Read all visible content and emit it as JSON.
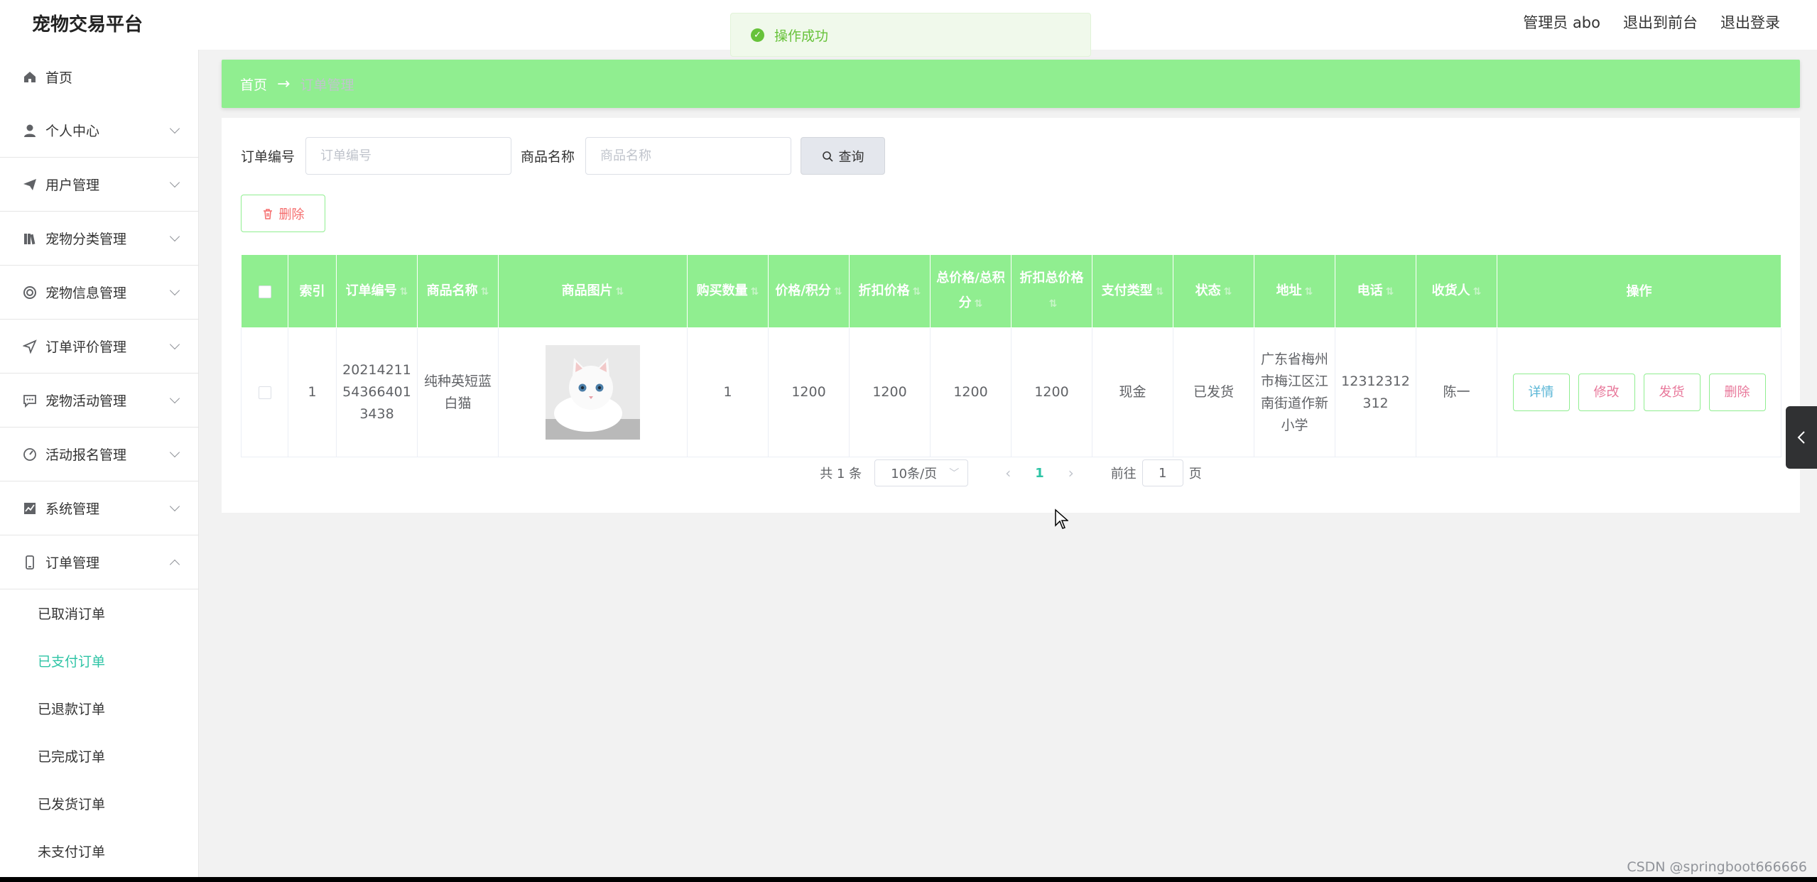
{
  "header": {
    "brand": "宠物交易平台",
    "admin_label": "管理员 abo",
    "back_to_front": "退出到前台",
    "logout": "退出登录"
  },
  "toast": {
    "message": "操作成功",
    "icon": "check-circle-icon",
    "color": "#67c23a"
  },
  "sidebar": {
    "items": [
      {
        "label": "首页",
        "icon": "home-icon"
      },
      {
        "label": "个人中心",
        "icon": "user-icon"
      },
      {
        "label": "用户管理",
        "icon": "send-icon"
      },
      {
        "label": "宠物分类管理",
        "icon": "books-icon"
      },
      {
        "label": "宠物信息管理",
        "icon": "circle-icon"
      },
      {
        "label": "订单评价管理",
        "icon": "navigation-icon"
      },
      {
        "label": "宠物活动管理",
        "icon": "chat-icon"
      },
      {
        "label": "活动报名管理",
        "icon": "gauge-icon"
      },
      {
        "label": "系统管理",
        "icon": "chart-icon"
      },
      {
        "label": "订单管理",
        "icon": "phone-icon"
      }
    ],
    "submenu": [
      {
        "label": "已取消订单"
      },
      {
        "label": "已支付订单",
        "active": true
      },
      {
        "label": "已退款订单"
      },
      {
        "label": "已完成订单"
      },
      {
        "label": "已发货订单"
      },
      {
        "label": "未支付订单"
      }
    ]
  },
  "breadcrumb": {
    "home": "首页",
    "separator": "→",
    "current": "订单管理"
  },
  "search": {
    "order_no_label": "订单编号",
    "order_no_placeholder": "订单编号",
    "product_label": "商品名称",
    "product_placeholder": "商品名称",
    "query_label": "查询"
  },
  "toolbar": {
    "delete_label": "删除"
  },
  "table": {
    "headers": {
      "index": "索引",
      "order_no": "订单编号",
      "product_name": "商品名称",
      "product_image": "商品图片",
      "quantity": "购买数量",
      "price": "价格/积分",
      "discount_price": "折扣价格",
      "total_price": "总价格/总积分",
      "discount_total": "折扣总价格",
      "pay_type": "支付类型",
      "status": "状态",
      "address": "地址",
      "phone": "电话",
      "receiver": "收货人",
      "actions": "操作"
    },
    "rows": [
      {
        "index": "1",
        "order_no": "202142115436​64013438",
        "product_name": "纯种英短蓝白猫",
        "product_image": "white-kitten-photo",
        "quantity": "1",
        "price": "1200",
        "discount_price": "1200",
        "total_price": "1200",
        "discount_total": "1200",
        "pay_type": "现金",
        "status": "已发货",
        "address": "广东省梅州市梅江区江南街道作新小学",
        "phone": "12312312312",
        "receiver": "陈一",
        "actions": {
          "detail": "详情",
          "edit": "修改",
          "ship": "发货",
          "delete": "删除"
        }
      }
    ]
  },
  "action_colors": {
    "detail": "#5ab6d6",
    "edit": "#e8779a",
    "ship": "#e8779a",
    "delete": "#e8779a"
  },
  "pagination": {
    "total": "共 1 条",
    "page_size": "10条/页",
    "current_page": "1",
    "goto_label": "前往",
    "goto_value": "1",
    "page_unit": "页"
  },
  "watermark": "CSDN @springboot666666"
}
